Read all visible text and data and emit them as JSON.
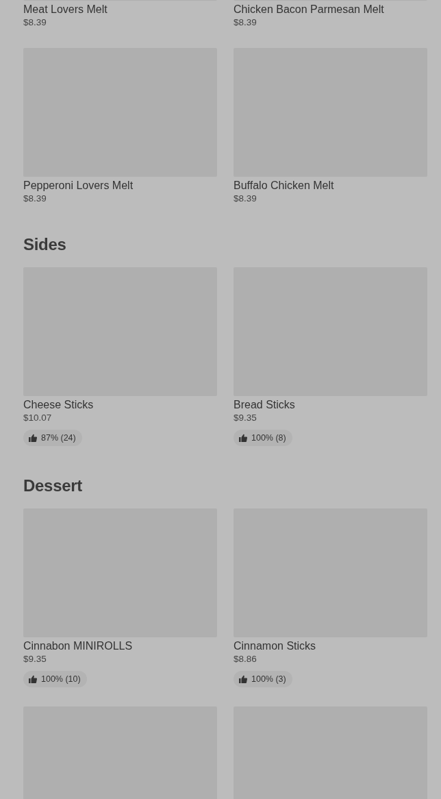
{
  "sections": [
    {
      "items": [
        {
          "kind": "dish",
          "name": "Meat Lovers Melt",
          "price": "$8.39"
        },
        {
          "kind": "dish",
          "name": "Chicken Bacon Parmesan Melt",
          "price": "$8.39"
        },
        {
          "kind": "dish",
          "name": "Pepperoni Lovers Melt",
          "price": "$8.39"
        },
        {
          "kind": "dish",
          "name": "Buffalo Chicken Melt",
          "price": "$8.39"
        }
      ]
    },
    {
      "title": "Sides",
      "items": [
        {
          "kind": "dish",
          "name": "Cheese Sticks",
          "price": "$10.07",
          "rating": "87% (24)"
        },
        {
          "kind": "dish",
          "name": "Bread Sticks",
          "price": "$9.35",
          "rating": "100% (8)"
        }
      ]
    },
    {
      "title": "Dessert",
      "items": [
        {
          "kind": "dish",
          "name": "Cinnabon MINIROLLS",
          "price": "$9.35",
          "rating": "100% (10)"
        },
        {
          "kind": "dish",
          "name": "Cinnamon Sticks",
          "price": "$8.86",
          "rating": "100% (3)"
        },
        {
          "kind": "picture"
        },
        {
          "kind": "picture"
        }
      ]
    }
  ]
}
